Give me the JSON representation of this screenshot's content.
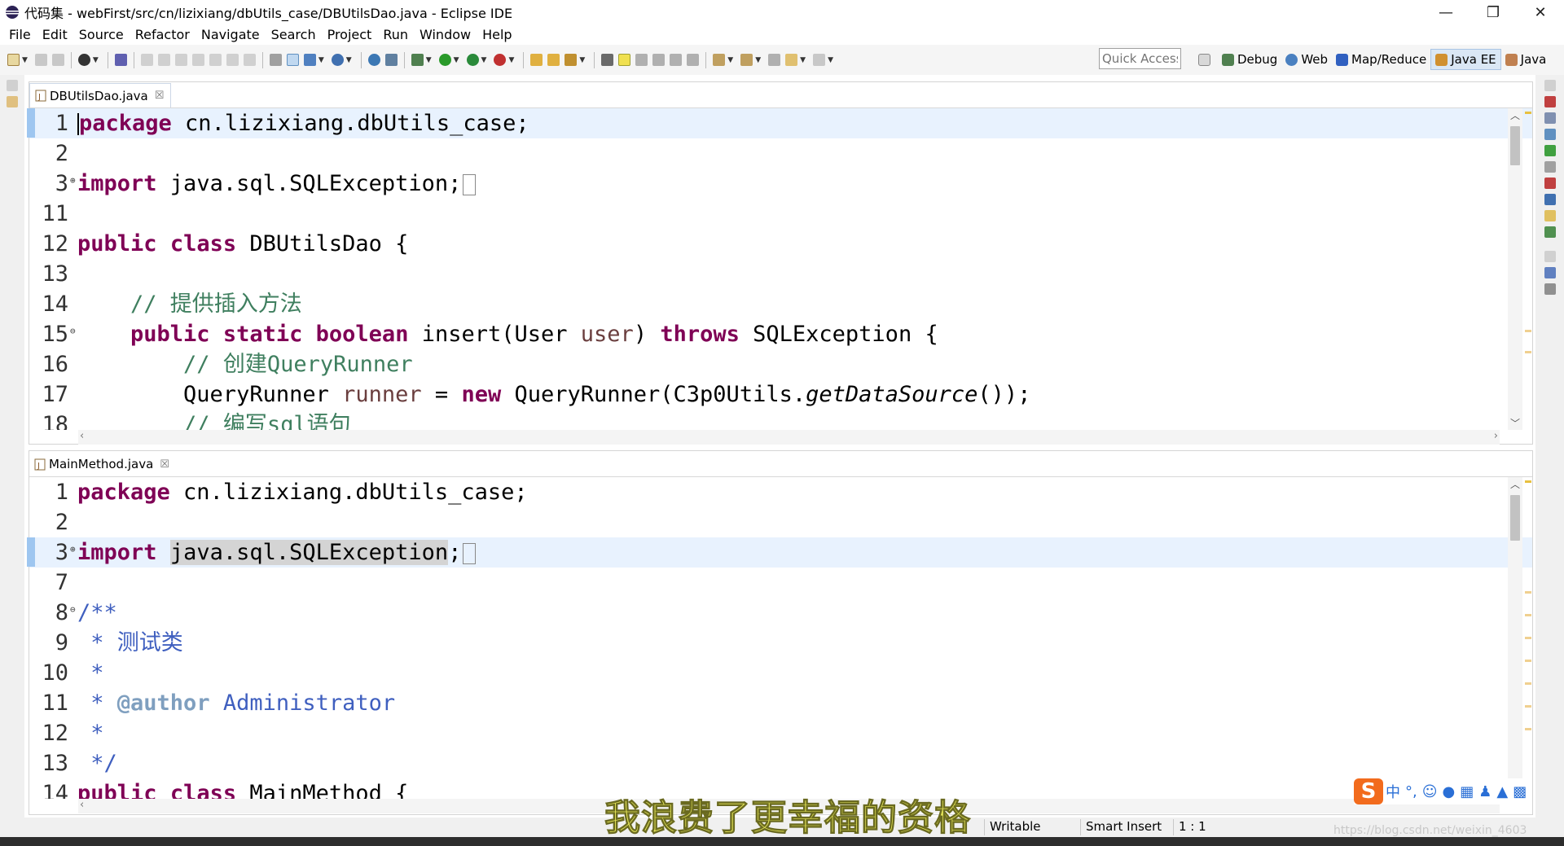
{
  "window": {
    "title": "代码集 - webFirst/src/cn/lizixiang/dbUtils_case/DBUtilsDao.java - Eclipse IDE",
    "controls": {
      "minimize": "—",
      "maximize": "❐",
      "close": "✕"
    }
  },
  "menu": [
    "File",
    "Edit",
    "Source",
    "Refactor",
    "Navigate",
    "Search",
    "Project",
    "Run",
    "Window",
    "Help"
  ],
  "toolbar": {
    "quick_access_placeholder": "Quick Access",
    "perspectives": [
      {
        "label": "Debug",
        "icon": "debug-bug-icon",
        "active": false
      },
      {
        "label": "Web",
        "icon": "web-globe-icon",
        "active": false
      },
      {
        "label": "Map/Reduce",
        "icon": "elephant-icon",
        "active": false
      },
      {
        "label": "Java EE",
        "icon": "java-ee-icon",
        "active": true
      },
      {
        "label": "Java",
        "icon": "java-icon",
        "active": false
      }
    ]
  },
  "editor1": {
    "tab_label": "DBUtilsDao.java",
    "tab_close": "☒",
    "lines": [
      {
        "n": "1",
        "fold": "",
        "parts": [
          [
            "kw",
            "package"
          ],
          [
            "",
            " cn.lizixiang.dbUtils_case;"
          ]
        ]
      },
      {
        "n": "2",
        "fold": "",
        "parts": []
      },
      {
        "n": "3",
        "fold": "⊕",
        "parts": [
          [
            "kw",
            "import"
          ],
          [
            "",
            " java.sql.SQLException;"
          ]
        ],
        "box": true
      },
      {
        "n": "11",
        "fold": "",
        "parts": []
      },
      {
        "n": "12",
        "fold": "",
        "parts": [
          [
            "kw",
            "public"
          ],
          [
            "",
            " "
          ],
          [
            "kw",
            "class"
          ],
          [
            "",
            " DBUtilsDao {"
          ]
        ]
      },
      {
        "n": "13",
        "fold": "",
        "parts": []
      },
      {
        "n": "14",
        "fold": "",
        "parts": [
          [
            "",
            "    "
          ],
          [
            "cm",
            "// 提供插入方法"
          ]
        ]
      },
      {
        "n": "15",
        "fold": "⊖",
        "parts": [
          [
            "",
            "    "
          ],
          [
            "kw",
            "public"
          ],
          [
            "",
            " "
          ],
          [
            "kw",
            "static"
          ],
          [
            "",
            " "
          ],
          [
            "kw",
            "boolean"
          ],
          [
            "",
            " insert(User "
          ],
          [
            "fld",
            "user"
          ],
          [
            "",
            ") "
          ],
          [
            "kw",
            "throws"
          ],
          [
            "",
            " SQLException {"
          ]
        ]
      },
      {
        "n": "16",
        "fold": "",
        "parts": [
          [
            "",
            "        "
          ],
          [
            "cm",
            "// 创建QueryRunner"
          ]
        ]
      },
      {
        "n": "17",
        "fold": "",
        "parts": [
          [
            "",
            "        QueryRunner "
          ],
          [
            "fld",
            "runner"
          ],
          [
            "",
            " = "
          ],
          [
            "kw",
            "new"
          ],
          [
            "",
            " QueryRunner(C3p0Utils."
          ],
          [
            "it",
            "getDataSource"
          ],
          [
            "",
            "());"
          ]
        ]
      },
      {
        "n": "18",
        "fold": "",
        "parts": [
          [
            "",
            "        "
          ],
          [
            "cm",
            "// 编写sql语句"
          ]
        ]
      }
    ]
  },
  "editor2": {
    "tab_label": "MainMethod.java",
    "tab_close": "☒",
    "lines": [
      {
        "n": "1",
        "fold": "",
        "parts": [
          [
            "kw",
            "package"
          ],
          [
            "",
            " cn.lizixiang.dbUtils_case;"
          ]
        ]
      },
      {
        "n": "2",
        "fold": "",
        "parts": []
      },
      {
        "n": "3",
        "fold": "⊕",
        "parts": [
          [
            "kw",
            "import"
          ],
          [
            "",
            " "
          ],
          [
            "sel",
            "java.sql.SQLException"
          ],
          [
            "",
            ";"
          ]
        ],
        "box": true
      },
      {
        "n": "7",
        "fold": "",
        "parts": []
      },
      {
        "n": "8",
        "fold": "⊖",
        "parts": [
          [
            "jd",
            "/**"
          ]
        ]
      },
      {
        "n": "9",
        "fold": "",
        "parts": [
          [
            "jd",
            " * 测试类"
          ]
        ]
      },
      {
        "n": "10",
        "fold": "",
        "parts": [
          [
            "jd",
            " *"
          ]
        ]
      },
      {
        "n": "11",
        "fold": "",
        "parts": [
          [
            "jd",
            " * "
          ],
          [
            "jt",
            "@author"
          ],
          [
            "jd",
            " Administrator"
          ]
        ]
      },
      {
        "n": "12",
        "fold": "",
        "parts": [
          [
            "jd",
            " *"
          ]
        ]
      },
      {
        "n": "13",
        "fold": "",
        "parts": [
          [
            "jd",
            " */"
          ]
        ]
      },
      {
        "n": "14",
        "fold": "",
        "parts": [
          [
            "kw",
            "public"
          ],
          [
            "",
            " "
          ],
          [
            "kw",
            "class"
          ],
          [
            "",
            " MainMethod {"
          ]
        ]
      }
    ]
  },
  "status": {
    "writable": "Writable",
    "insert_mode": "Smart Insert",
    "position": "1 : 1"
  },
  "overlay": {
    "subtitle": "我浪费了更幸福的资格",
    "ime_logo": "S",
    "ime_mode": "中",
    "ime_punct": "°,",
    "watermark": "https://blog.csdn.net/weixin_4603"
  },
  "colors": {
    "keyword": "#7f0055",
    "comment": "#3f7f5f",
    "javadoc": "#3f5fbf",
    "current_line": "#e8f2fe",
    "active_perspective": "#dae7f5"
  }
}
